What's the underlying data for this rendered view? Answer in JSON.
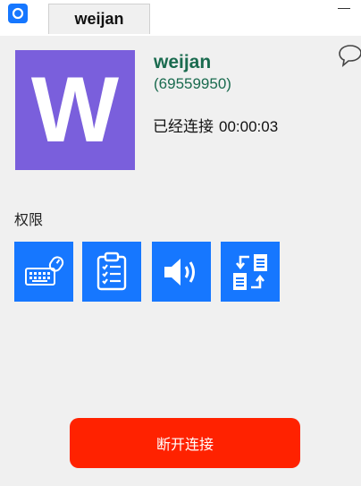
{
  "tab": {
    "label": "weijan"
  },
  "peer": {
    "avatar_letter": "W",
    "name": "weijan",
    "id": "(69559950)",
    "status": "已经连接",
    "duration": "00:00:03"
  },
  "permissions": {
    "label": "权限",
    "items": [
      {
        "icon": "keyboard-mouse-icon"
      },
      {
        "icon": "clipboard-icon"
      },
      {
        "icon": "audio-icon"
      },
      {
        "icon": "file-transfer-icon"
      }
    ]
  },
  "actions": {
    "disconnect_label": "断开连接"
  },
  "colors": {
    "accent": "#1677ff",
    "avatar": "#7a5fdc",
    "peer_text": "#1a6b4f",
    "disconnect": "#ff2200"
  }
}
